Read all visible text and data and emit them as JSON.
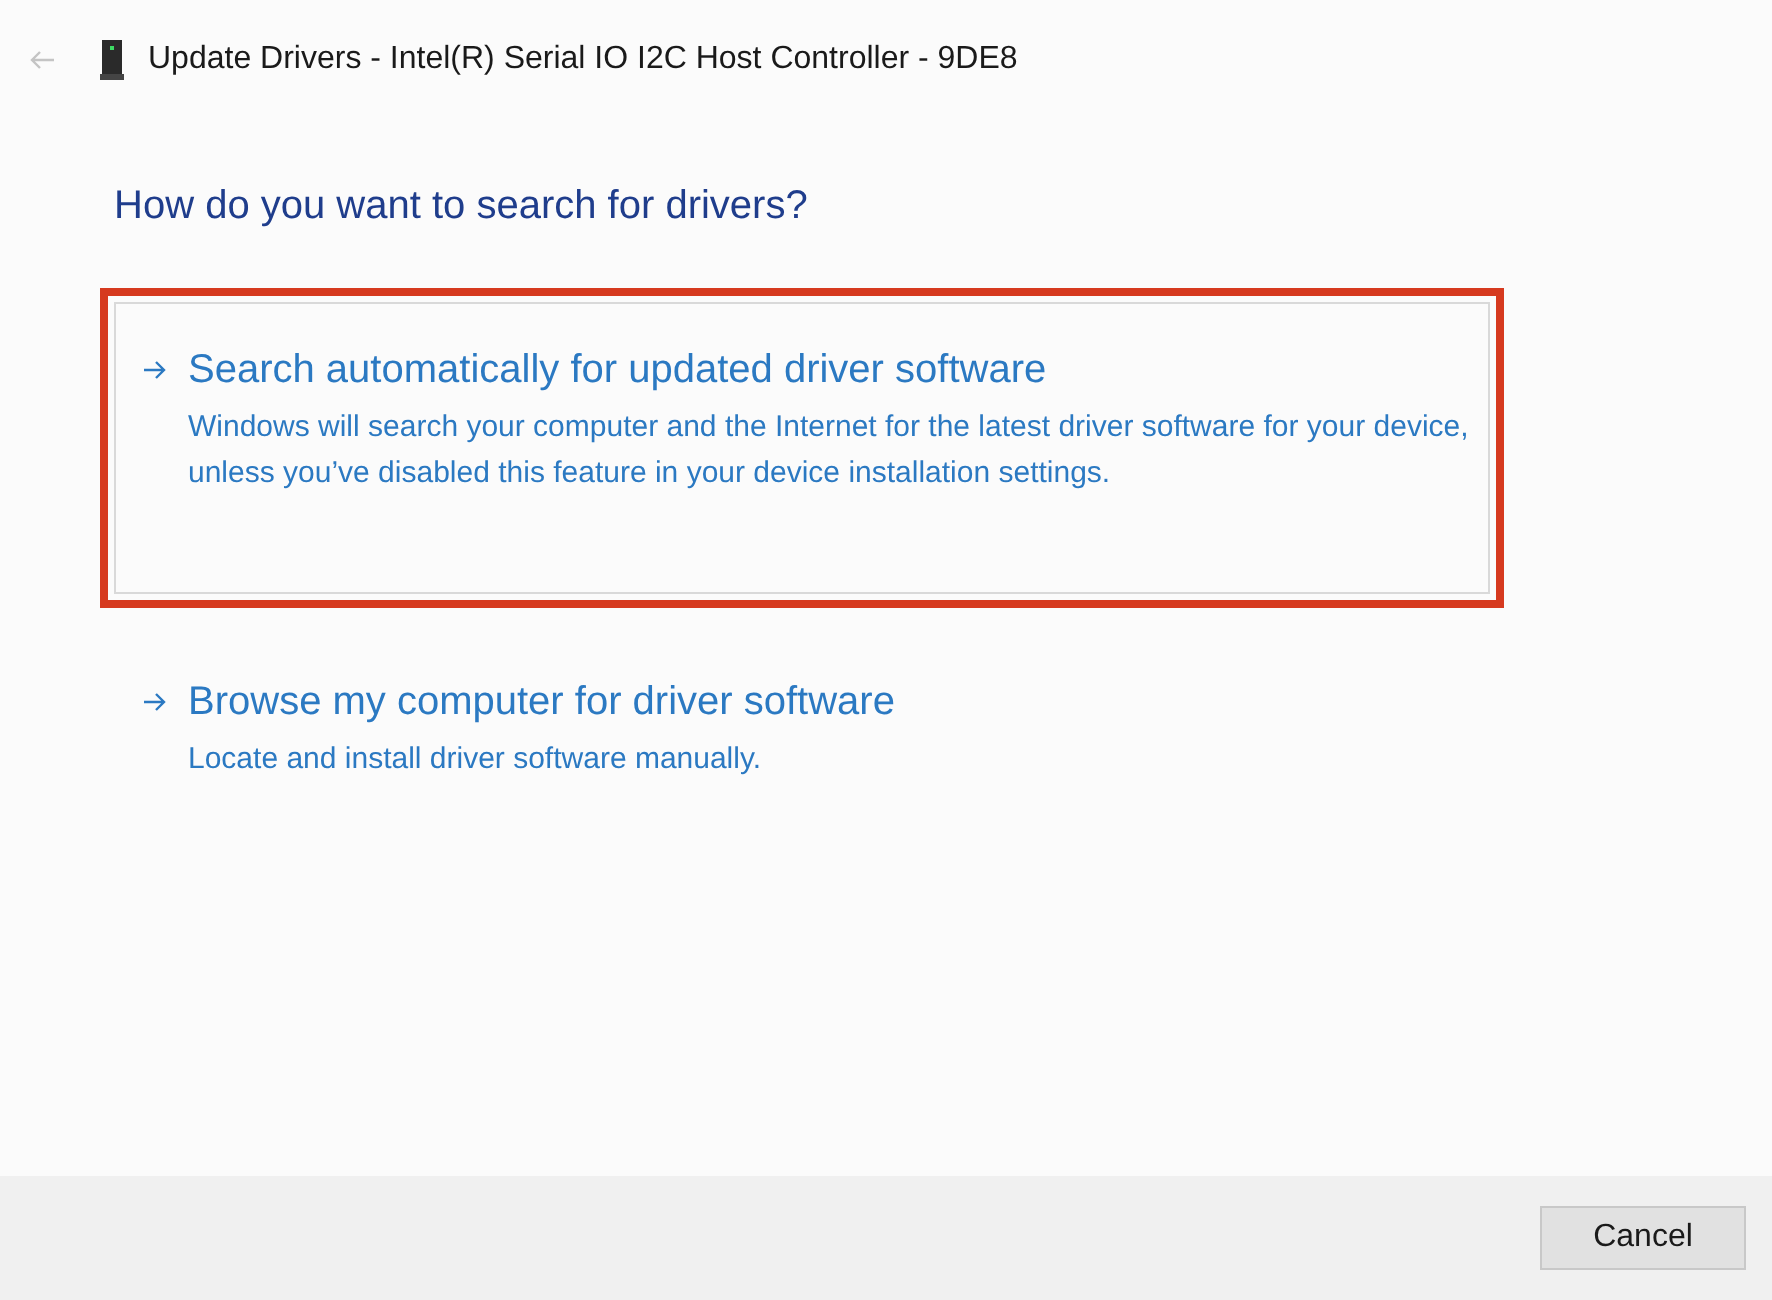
{
  "window": {
    "title": "Update Drivers - Intel(R) Serial IO I2C Host Controller - 9DE8"
  },
  "heading": "How do you want to search for drivers?",
  "options": [
    {
      "title": "Search automatically for updated driver software",
      "description": "Windows will search your computer and the Internet for the latest driver software for your device, unless you’ve disabled this feature in your device installation settings.",
      "selected": true
    },
    {
      "title": "Browse my computer for driver software",
      "description": "Locate and install driver software manually.",
      "selected": false
    }
  ],
  "buttons": [
    "Cancel"
  ]
}
